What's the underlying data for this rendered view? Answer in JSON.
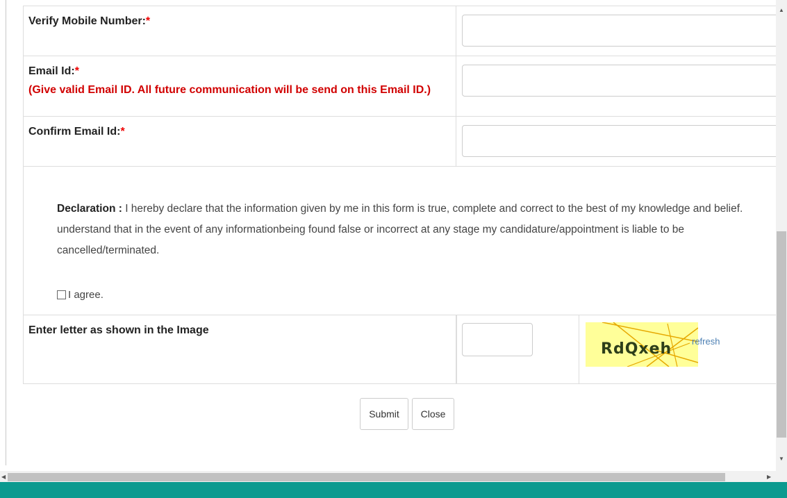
{
  "form": {
    "verify_mobile_label": "Verify Mobile Number:",
    "email_label": "Email Id:",
    "email_note": "(Give valid Email ID. All future communication will be send on this Email ID.)",
    "confirm_email_label": "Confirm Email Id:",
    "required_mark": "*",
    "declaration_heading": "Declaration :",
    "declaration_text": " I hereby declare that the information given by me in this form is true, complete and correct to the best of my knowledge and belief. understand that in the event of any informationbeing found false or incorrect at any stage my candidature/appointment is liable to be cancelled/terminated.",
    "agree_label": "I agree.",
    "captcha_label": "Enter letter as shown in the Image",
    "captcha_text": "RdQxeh",
    "refresh_label": "refresh",
    "submit_label": "Submit",
    "close_label": "Close"
  },
  "colors": {
    "required": "#e00000",
    "note": "#d10000",
    "footer_bar": "#0b9a8f",
    "captcha_bg": "#ffff99",
    "link": "#4b7fb3"
  },
  "icons": {
    "scroll_up": "triangle-up",
    "scroll_down": "triangle-down",
    "scroll_left": "triangle-left",
    "scroll_right": "triangle-right"
  }
}
